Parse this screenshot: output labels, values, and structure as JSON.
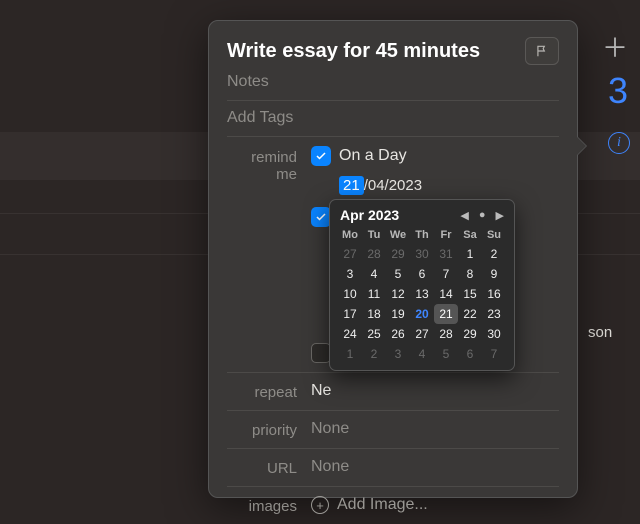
{
  "right_sidebar": {
    "add_icon_glyph": "＋",
    "day_number": "3",
    "info_glyph": "i"
  },
  "truncated_text": "son",
  "popover": {
    "title": "Write essay for 45 minutes",
    "notes_placeholder": "Notes",
    "tags_placeholder": "Add Tags",
    "remind_me_label": "remind me",
    "on_a_day_label": "On a Day",
    "date_selected_segment": "21",
    "date_rest": "/04/2023",
    "repeat_label": "repeat",
    "repeat_value": "Ne",
    "priority_label": "priority",
    "priority_value": "None",
    "url_label": "URL",
    "url_value": "None",
    "images_label": "images",
    "add_image_label": "Add Image..."
  },
  "calendar": {
    "month_label": "Apr 2023",
    "weekdays": [
      "Mo",
      "Tu",
      "We",
      "Th",
      "Fr",
      "Sa",
      "Su"
    ],
    "days": [
      {
        "n": "27",
        "out": true
      },
      {
        "n": "28",
        "out": true
      },
      {
        "n": "29",
        "out": true
      },
      {
        "n": "30",
        "out": true
      },
      {
        "n": "31",
        "out": true
      },
      {
        "n": "1"
      },
      {
        "n": "2"
      },
      {
        "n": "3"
      },
      {
        "n": "4"
      },
      {
        "n": "5"
      },
      {
        "n": "6"
      },
      {
        "n": "7"
      },
      {
        "n": "8"
      },
      {
        "n": "9"
      },
      {
        "n": "10"
      },
      {
        "n": "11"
      },
      {
        "n": "12"
      },
      {
        "n": "13"
      },
      {
        "n": "14"
      },
      {
        "n": "15"
      },
      {
        "n": "16"
      },
      {
        "n": "17"
      },
      {
        "n": "18"
      },
      {
        "n": "19"
      },
      {
        "n": "20",
        "today": true
      },
      {
        "n": "21",
        "sel": true
      },
      {
        "n": "22"
      },
      {
        "n": "23"
      },
      {
        "n": "24"
      },
      {
        "n": "25"
      },
      {
        "n": "26"
      },
      {
        "n": "27"
      },
      {
        "n": "28"
      },
      {
        "n": "29"
      },
      {
        "n": "30"
      },
      {
        "n": "1",
        "out": true
      },
      {
        "n": "2",
        "out": true
      },
      {
        "n": "3",
        "out": true
      },
      {
        "n": "4",
        "out": true
      },
      {
        "n": "5",
        "out": true
      },
      {
        "n": "6",
        "out": true
      },
      {
        "n": "7",
        "out": true
      }
    ]
  }
}
